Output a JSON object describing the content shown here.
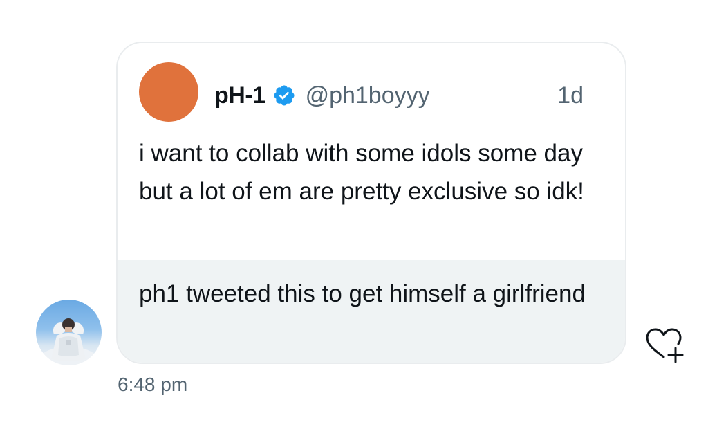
{
  "quoted_tweet": {
    "display_name": "pH-1",
    "handle": "@ph1boyyy",
    "time_ago": "1d",
    "text": "i want to collab with some idols some day but a lot of em are pretty exclusive so idk!",
    "avatar_color": "#e0723c",
    "verified_color": "#1d9bf0"
  },
  "message": {
    "text": "ph1 tweeted this to get himself a girlfriend",
    "sent_time": "6:48 pm",
    "bubble_color": "#eff3f4"
  },
  "icons": {
    "verified": "verified-badge-icon",
    "react": "heart-plus-icon"
  }
}
